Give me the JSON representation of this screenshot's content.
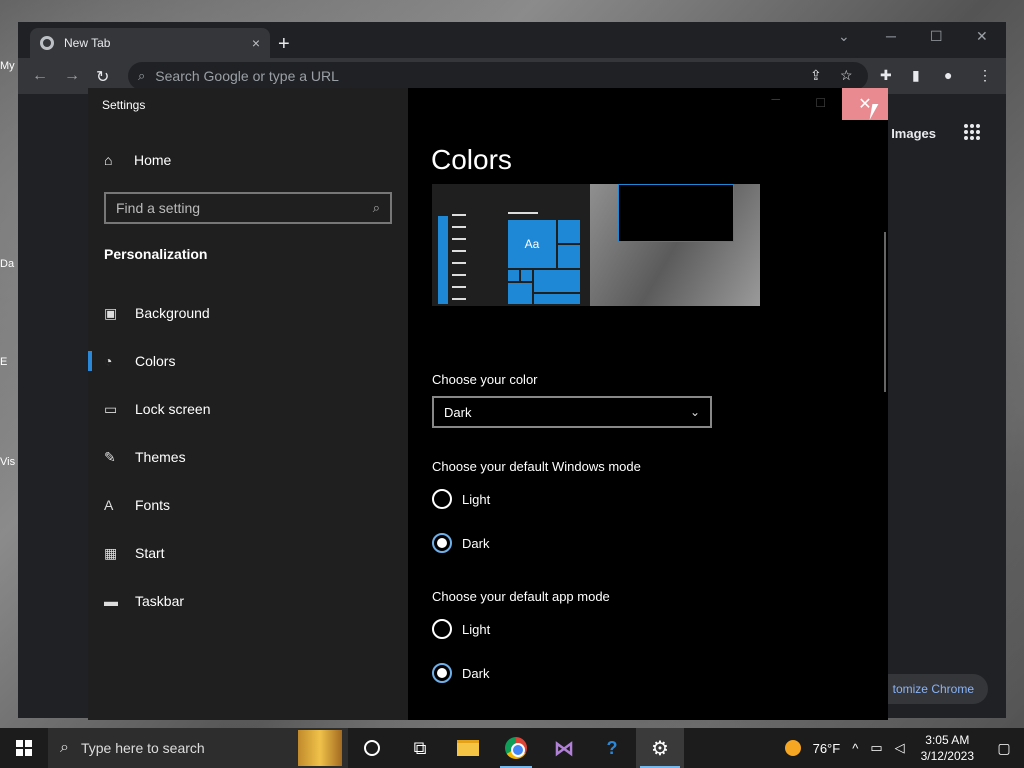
{
  "desktop": {
    "icons": [
      "My",
      "Da",
      "E",
      "Vis"
    ]
  },
  "chrome": {
    "tab_title": "New Tab",
    "tab_close": "×",
    "new_tab": "+",
    "omnibox_placeholder": "Search Google or type a URL",
    "images_link": "Images",
    "customize": "tomize Chrome",
    "win_min": "─",
    "win_max": "☐",
    "win_close": "✕",
    "back": "←",
    "forward": "→",
    "reload": "↻"
  },
  "settings": {
    "window_title": "Settings",
    "home_label": "Home",
    "search_placeholder": "Find a setting",
    "section": "Personalization",
    "nav": [
      {
        "label": "Background",
        "icon": "picture-icon"
      },
      {
        "label": "Colors",
        "icon": "palette-icon"
      },
      {
        "label": "Lock screen",
        "icon": "lock-screen-icon"
      },
      {
        "label": "Themes",
        "icon": "brush-icon"
      },
      {
        "label": "Fonts",
        "icon": "font-icon"
      },
      {
        "label": "Start",
        "icon": "start-icon"
      },
      {
        "label": "Taskbar",
        "icon": "taskbar-icon"
      }
    ],
    "active_nav": "Colors",
    "page_title": "Colors",
    "preview_tile_text": "Aa",
    "choose_color_label": "Choose your color",
    "choose_color_value": "Dark",
    "windows_mode_label": "Choose your default Windows mode",
    "windows_mode_options": [
      "Light",
      "Dark"
    ],
    "windows_mode_selected": "Dark",
    "app_mode_label": "Choose your default app mode",
    "app_mode_options": [
      "Light",
      "Dark"
    ],
    "app_mode_selected": "Dark",
    "close_symbol": "✕",
    "accent_color": "#1e88d6"
  },
  "taskbar": {
    "search_placeholder": "Type here to search",
    "weather": "76°F",
    "time": "3:05 AM",
    "date": "3/12/2023",
    "tray_chevron": "^",
    "apps": [
      "cortana-icon",
      "task-view-icon",
      "file-explorer-icon",
      "chrome-icon",
      "visual-studio-icon",
      "help-icon",
      "settings-gear-icon"
    ]
  }
}
